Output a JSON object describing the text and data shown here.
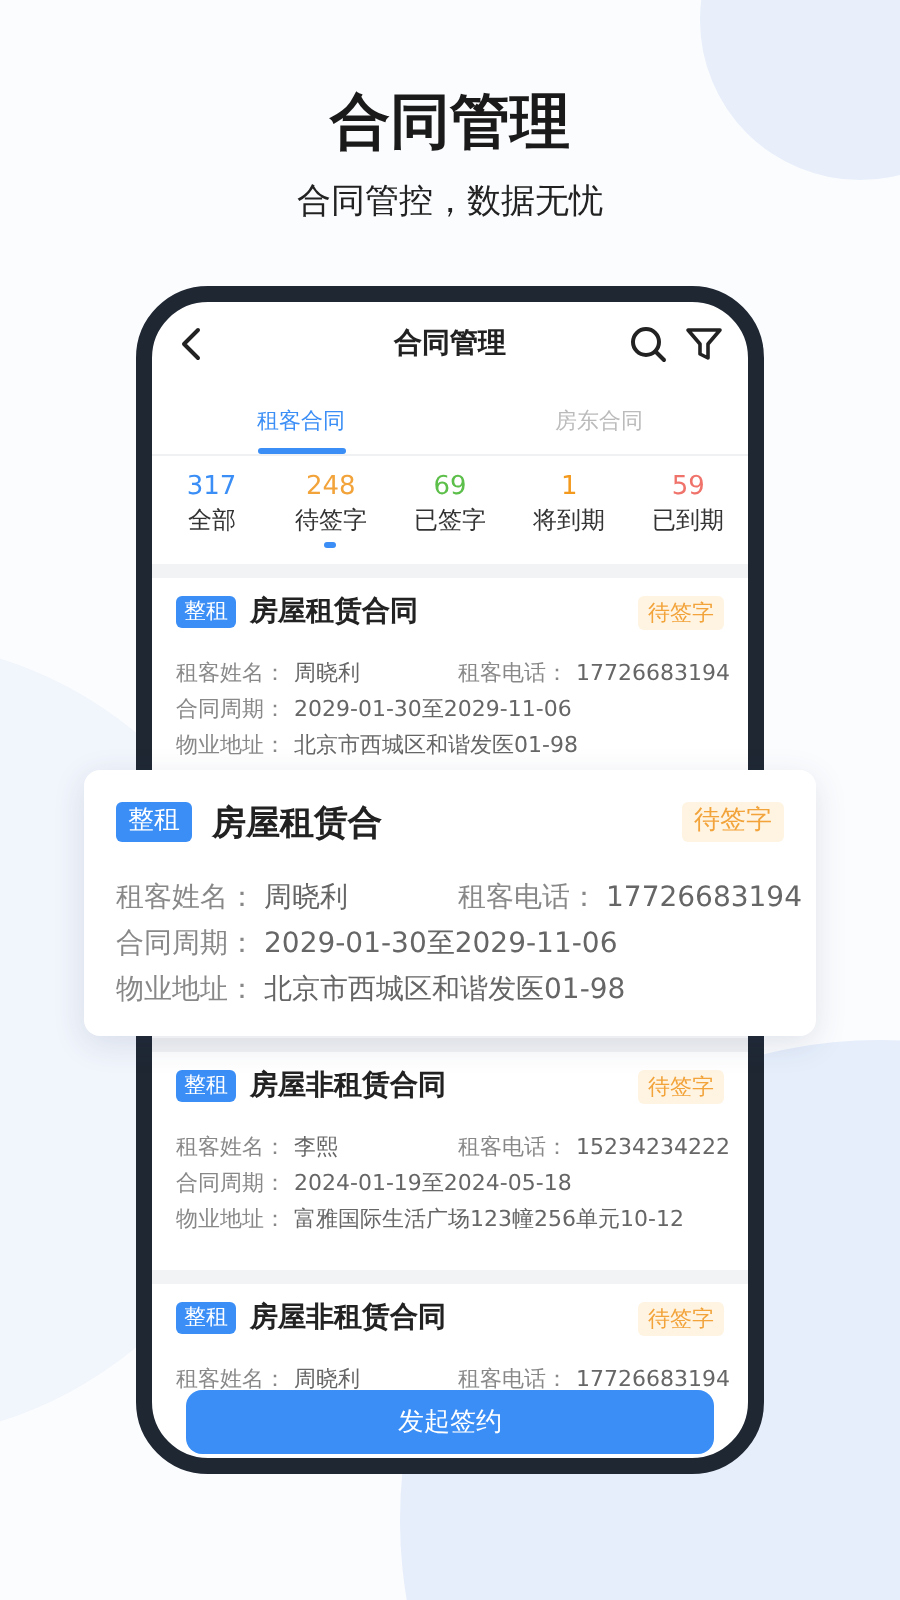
{
  "header": {
    "title": "合同管理",
    "subtitle": "合同管控，数据无忧"
  },
  "phone": {
    "nav": {
      "title": "合同管理"
    },
    "tabs": [
      {
        "label": "租客合同",
        "selected": true
      },
      {
        "label": "房东合同",
        "selected": false
      }
    ],
    "stats": [
      {
        "count": "317",
        "label": "全部",
        "color": "#3a8ef6",
        "selected": false
      },
      {
        "count": "248",
        "label": "待签字",
        "color": "#f2a33a",
        "selected": true
      },
      {
        "count": "69",
        "label": "已签字",
        "color": "#5cbf4a",
        "selected": false
      },
      {
        "count": "1",
        "label": "将到期",
        "color": "#f39a1e",
        "selected": false
      },
      {
        "count": "59",
        "label": "已到期",
        "color": "#f0736b",
        "selected": false
      }
    ],
    "contracts": [
      {
        "tag": "整租",
        "title": "房屋租赁合同",
        "status": "待签字",
        "rows": [
          [
            {
              "label": "租客姓名：",
              "value": "周晓利"
            },
            {
              "label": "租客电话：",
              "value": "17726683194"
            }
          ],
          [
            {
              "label": "合同周期：",
              "value": "2029-01-30至2029-11-06"
            }
          ],
          [
            {
              "label": "物业地址：",
              "value": "北京市西城区和谐发医01-98"
            }
          ]
        ]
      },
      {
        "tag": "整租",
        "title": "房屋非租赁合同",
        "status": "待签字",
        "rows": [
          [
            {
              "label": "租客姓名：",
              "value": "李熙"
            },
            {
              "label": "租客电话：",
              "value": "15234234222"
            }
          ],
          [
            {
              "label": "合同周期：",
              "value": "2024-01-19至2024-05-18"
            }
          ],
          [
            {
              "label": "物业地址：",
              "value": "富雅国际生活广场123幢256单元10-12"
            }
          ]
        ]
      },
      {
        "tag": "整租",
        "title": "房屋非租赁合同",
        "status": "待签字",
        "rows": [
          [
            {
              "label": "租客姓名：",
              "value": "周晓利"
            },
            {
              "label": "租客电话：",
              "value": "17726683194"
            }
          ]
        ]
      }
    ],
    "button": "发起签约"
  },
  "popup": {
    "tag": "整租",
    "title": "房屋租赁合",
    "status": "待签字",
    "rows": [
      [
        {
          "label": "租客姓名：",
          "value": "周晓利"
        },
        {
          "label": "租客电话：",
          "value": "17726683194"
        }
      ],
      [
        {
          "label": "合同周期：",
          "value": "2029-01-30至2029-11-06"
        }
      ],
      [
        {
          "label": "物业地址：",
          "value": "北京市西城区和谐发医01-98"
        }
      ]
    ]
  }
}
